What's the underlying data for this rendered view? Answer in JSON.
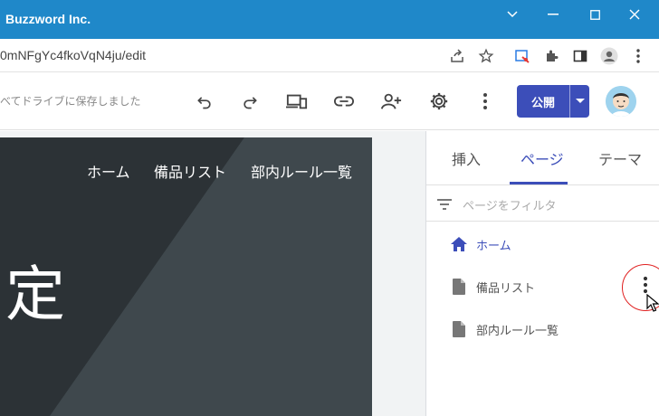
{
  "window": {
    "title": "Buzzword Inc."
  },
  "address": {
    "url": "0mNFgYc4fkoVqN4ju/edit"
  },
  "toolbar": {
    "saved_status": "べてドライブに保存しました",
    "publish_label": "公開"
  },
  "hero": {
    "nav": [
      "ホーム",
      "備品リスト",
      "部内ルール一覧"
    ],
    "title": "定"
  },
  "panel": {
    "tabs": [
      "挿入",
      "ページ",
      "テーマ"
    ],
    "active_tab": "ページ",
    "filter_placeholder": "ページをフィルタ",
    "pages": [
      {
        "label": "ホーム",
        "icon": "home-icon"
      },
      {
        "label": "備品リスト",
        "icon": "page-icon"
      },
      {
        "label": "部内ルール一覧",
        "icon": "page-icon"
      }
    ]
  },
  "colors": {
    "titlebar": "#1f88c9",
    "accent": "#3c4eb9",
    "highlight": "#e02020",
    "hero": "#3a4247"
  }
}
